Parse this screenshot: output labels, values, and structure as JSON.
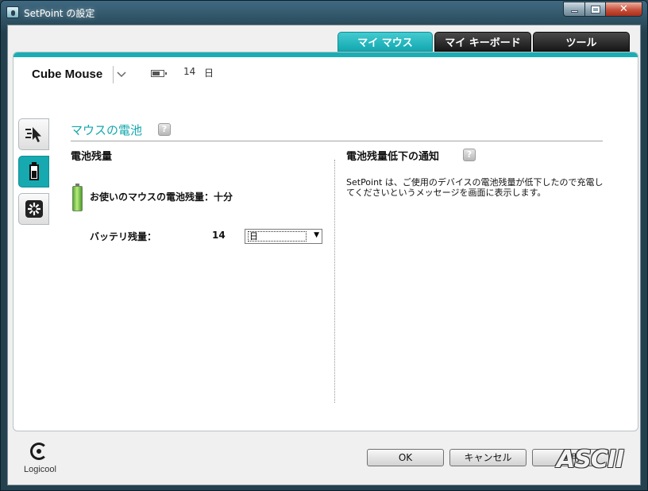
{
  "window": {
    "title": "SetPoint の設定",
    "controls": {
      "minimize": "minimize",
      "maximize": "maximize",
      "close": "close"
    }
  },
  "tabs": [
    {
      "label": "マイ マウス",
      "active": true
    },
    {
      "label": "マイ キーボード",
      "active": false
    },
    {
      "label": "ツール",
      "active": false
    }
  ],
  "device": {
    "name": "Cube Mouse",
    "days_count": "14",
    "days_unit": "日"
  },
  "side_tabs": [
    {
      "icon": "pointer-speed-icon",
      "active": false
    },
    {
      "icon": "battery-icon",
      "active": true
    },
    {
      "icon": "settings-icon",
      "active": false
    }
  ],
  "section": {
    "title": "マウスの電池",
    "help": "?"
  },
  "battery": {
    "heading": "電池残量",
    "status_text": "お使いのマウスの電池残量：十分",
    "level_label": "バッテリ残量：",
    "level_value": "14",
    "unit_selected": "日"
  },
  "notification": {
    "heading": "電池残量低下の通知",
    "help": "?",
    "description": "SetPoint は、ご使用のデバイスの電池残量が低下したので充電してくださいというメッセージを画面に表示します。"
  },
  "footer": {
    "logo_text": "Logicool",
    "ok": "OK",
    "cancel": "キャンセル",
    "apply": "適用",
    "watermark": "ASCII"
  },
  "colors": {
    "accent": "#16a9b0",
    "title_bar": "#23414f"
  }
}
